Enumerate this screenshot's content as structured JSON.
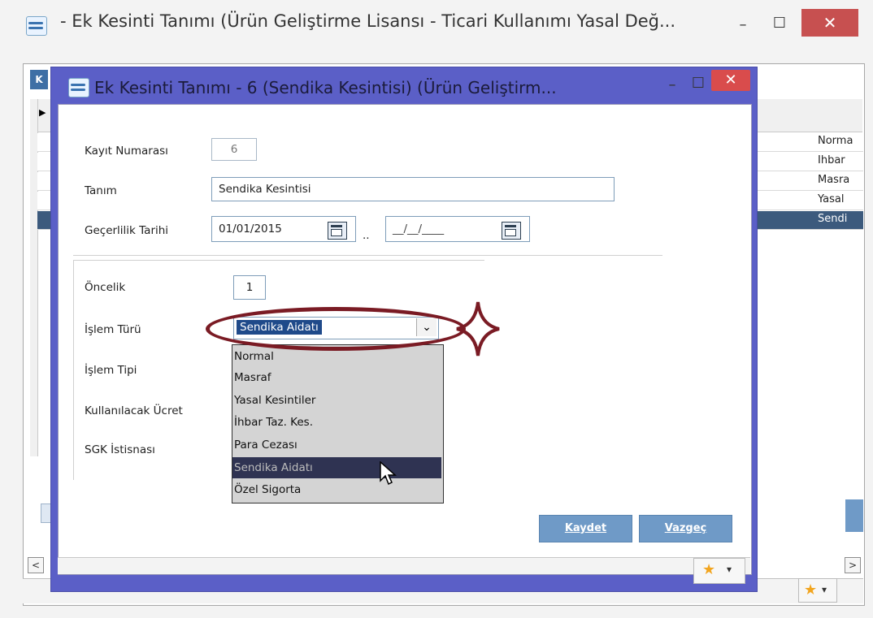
{
  "outer_window": {
    "title": "- Ek Kesinti Tanımı (Ürün Geliştirme Lisansı - Ticari Kullanımı Yasal Değ...",
    "min_label": "–",
    "max_label": "☐",
    "close_label": "✕",
    "tab_stub": "K",
    "grid_rows": [
      "Norma",
      "İhbar",
      "Masra",
      "Yasal",
      "Sendi"
    ],
    "scroll_left": "<",
    "scroll_right": ">",
    "fav_arrow": "▾"
  },
  "dialog": {
    "title": "Ek Kesinti Tanımı - 6 (Sendika Kesintisi) (Ürün Geliştirm...",
    "min_label": "–",
    "max_label": "☐",
    "close_label": "✕",
    "fields": {
      "kayit_label": "Kayıt Numarası",
      "kayit_value": "6",
      "tanim_label": "Tanım",
      "tanim_value": "Sendika Kesintisi",
      "gecerlilik_label": "Geçerlilik Tarihi",
      "date_from": "01/01/2015",
      "date_sep": "..",
      "date_to": "__/__/____",
      "oncelik_label": "Öncelik",
      "oncelik_value": "1",
      "islem_turu_label": "İşlem Türü",
      "islem_turu_value": "Sendika Aidatı",
      "islem_tipi_label": "İşlem Tipi",
      "kullanilacak_label": "Kullanılacak Ücret",
      "sgk_label": "SGK İstisnası"
    },
    "dropdown_options": [
      "Normal",
      "Masraf",
      "Yasal Kesintiler",
      "İhbar Taz. Kes.",
      "Para Cezası",
      "Sendika Aidatı",
      "Özel Sigorta"
    ],
    "selected_option": "Sendika Aidatı",
    "buttons": {
      "save": "Kaydet",
      "cancel": "Vazgeç"
    },
    "fav_arrow": "▾"
  },
  "colors": {
    "dialog_frame": "#5b5fc7",
    "selection": "#2f3352",
    "annotation": "#7a1b24",
    "button": "#6f9ac7",
    "close": "#d94c4c"
  }
}
